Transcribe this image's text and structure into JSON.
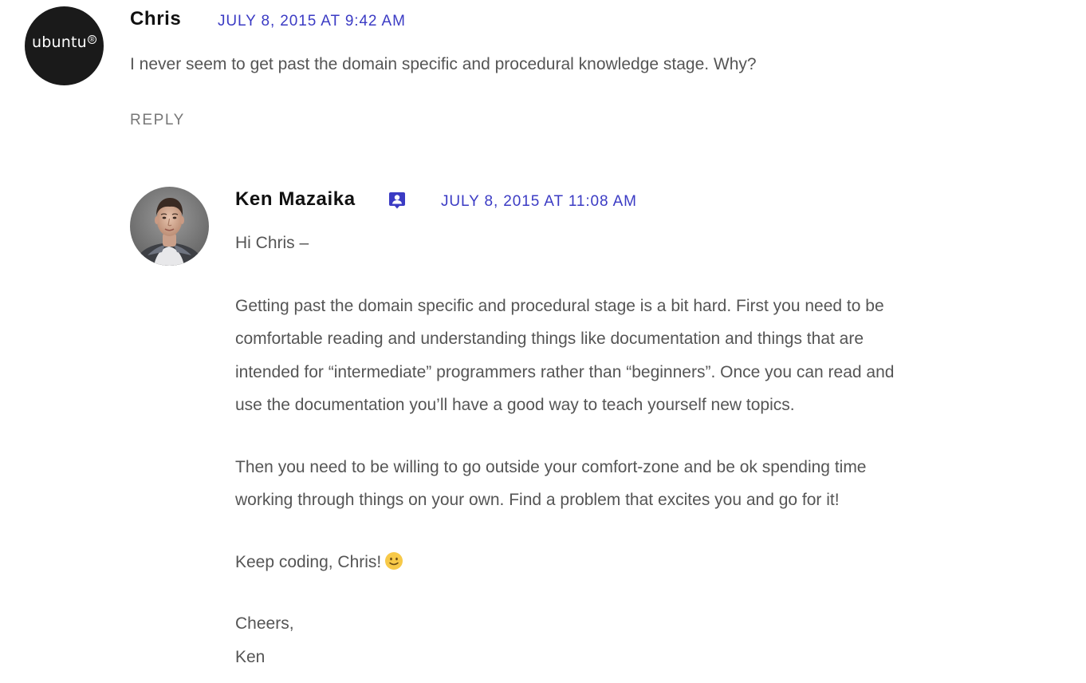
{
  "comments": [
    {
      "author": "Chris",
      "avatar_text": "ubuntu",
      "avatar_icon": "ubuntu-logo-icon",
      "date": "JULY 8, 2015 AT 9:42 AM",
      "text": "I never seem to get past the domain specific and procedural knowledge stage. Why?",
      "reply_label": "REPLY"
    }
  ],
  "reply": {
    "author": "Ken Mazaika",
    "avatar_icon": "user-photo-avatar",
    "badge_icon": "post-author-badge-icon",
    "date": "JULY 8, 2015 AT 11:08 AM",
    "greeting": "Hi Chris –",
    "paragraph1_lines": [
      "Getting past the domain specific and procedural stage is a bit hard. First you need to be",
      "comfortable reading and understanding things like documentation and things that are",
      "intended for “intermediate” programmers rather than “beginners”. Once you can read and",
      "use the documentation you’ll have a good way to teach yourself new topics."
    ],
    "paragraph2_lines": [
      "Then you need to be willing to go outside your comfort-zone and be ok spending time",
      "working through things on your own. Find a problem that excites you and go for it!"
    ],
    "signoff": "Keep coding, Chris!",
    "signoff_emoji": "slightly-smiling-face-emoji",
    "closing": "Cheers,",
    "signature": "Ken"
  },
  "colors": {
    "link": "#3b3bc4",
    "body_text": "#555555",
    "author_text": "#111111",
    "reply_link": "#777777",
    "avatar_bg": "#1a1a1a",
    "emoji": "#f7c948"
  }
}
